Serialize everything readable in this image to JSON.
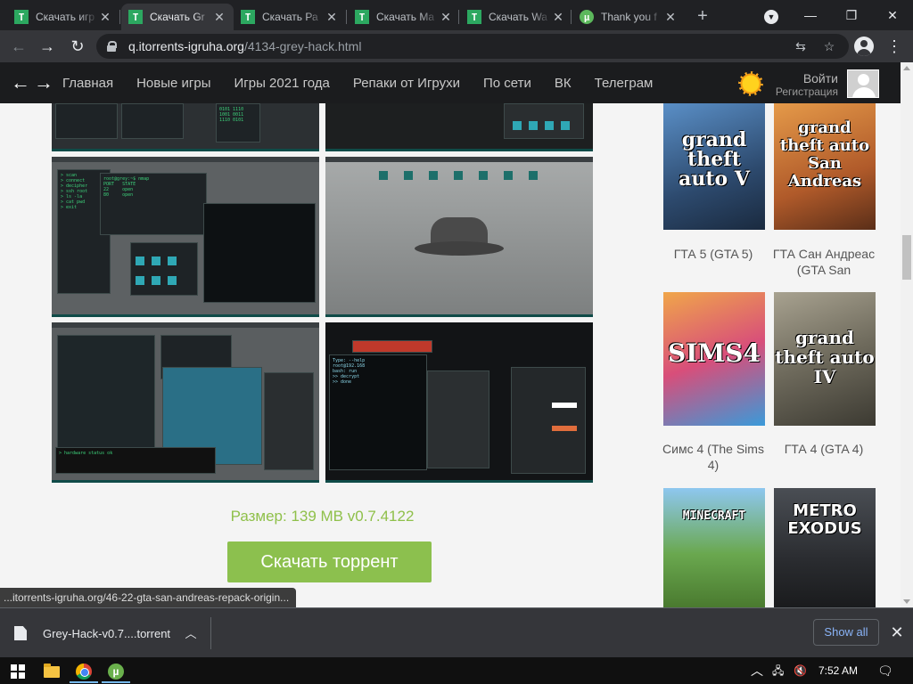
{
  "browser": {
    "tabs": [
      {
        "label": "Скачать игр",
        "favicon": "T",
        "active": false
      },
      {
        "label": "Скачать Gr",
        "favicon": "T",
        "active": true
      },
      {
        "label": "Скачать Ра",
        "favicon": "T",
        "active": false
      },
      {
        "label": "Скачать Ma",
        "favicon": "T",
        "active": false
      },
      {
        "label": "Скачать Wa",
        "favicon": "T",
        "active": false
      },
      {
        "label": "Thank you f",
        "favicon": "utorrent",
        "active": false
      }
    ],
    "url_host": "q.itorrents-igruha.org",
    "url_path": "/4134-grey-hack.html"
  },
  "site_nav": {
    "links": [
      "Главная",
      "Новые игры",
      "Игры 2021 года",
      "Репаки от Игрухи",
      "По сети",
      "ВК",
      "Телеграм"
    ],
    "login": "Войти",
    "register": "Регистрация"
  },
  "main": {
    "size_label": "Размер: 139 MB v0.7.4122",
    "download_button": "Скачать торрент",
    "hover_url": "...itorrents-igruha.org/46-22-gta-san-andreas-repack-origin..."
  },
  "sidebar": {
    "games": [
      {
        "title": "ГТА 5 (GTA 5)",
        "cover_text": "grand theft auto V",
        "cover_color": "#3a6ea5"
      },
      {
        "title": "ГТА Сан Андреас (GTA San",
        "cover_text": "grand theft auto San Andreas",
        "cover_color": "#c96a2b"
      },
      {
        "title": "Симс 4 (The Sims 4)",
        "cover_text": "SIMS4",
        "cover_color": "#c8416b"
      },
      {
        "title": "ГТА 4 (GTA 4)",
        "cover_text": "grand theft auto IV",
        "cover_color": "#6e6a5c"
      },
      {
        "title": "",
        "cover_text": "MINECRAFT",
        "cover_color": "#5d9e3a"
      },
      {
        "title": "",
        "cover_text": "METRO EXODUS",
        "cover_color": "#3c3f44"
      }
    ]
  },
  "downloads": {
    "file_name": "Grey-Hack-v0.7....torrent",
    "show_all": "Show all"
  },
  "taskbar": {
    "time": "7:52 AM"
  },
  "colors": {
    "accent_green": "#8cc04e",
    "chrome_dark": "#202124",
    "chrome_toolbar": "#35363a",
    "link_blue": "#8ab4f8"
  }
}
